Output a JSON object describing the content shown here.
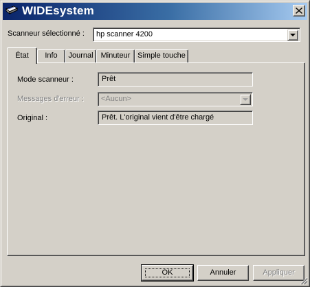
{
  "window": {
    "title": "WIDEsystem",
    "icon": "scanner-icon",
    "close_icon": "close-icon"
  },
  "scanner": {
    "label": "Scanneur sélectionné :",
    "selected": "hp scanner 4200"
  },
  "tabs": [
    {
      "label": "État",
      "active": true
    },
    {
      "label": "Info",
      "active": false
    },
    {
      "label": "Journal",
      "active": false
    },
    {
      "label": "Minuteur",
      "active": false
    },
    {
      "label": "Simple touche",
      "active": false
    }
  ],
  "status": {
    "mode_label": "Mode scanneur :",
    "mode_value": "Prêt",
    "errors_label": "Messages d'erreur :",
    "errors_value": "<Aucun>",
    "original_label": "Original :",
    "original_value": "Prêt. L'original vient d'être chargé"
  },
  "buttons": {
    "ok": "OK",
    "cancel": "Annuler",
    "apply": "Appliquer"
  },
  "colors": {
    "title_gradient_start": "#0a246a",
    "title_gradient_end": "#a6caf0",
    "face": "#d4d0c8"
  }
}
